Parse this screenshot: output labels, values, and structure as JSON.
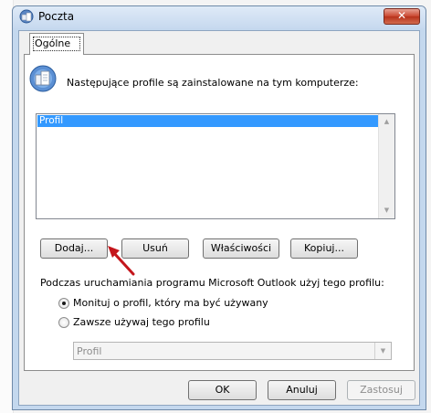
{
  "window": {
    "title": "Poczta",
    "close_symbol": "✕"
  },
  "tabs": [
    {
      "label": "Ogólne",
      "selected": true
    }
  ],
  "profiles": {
    "intro_label": "Następujące profile są zainstalowane na tym komputerze:",
    "items": [
      "Profil"
    ],
    "selected_index": 0
  },
  "actions": {
    "add_label": "Dodaj...",
    "remove_label": "Usuń",
    "properties_label": "Właściwości",
    "copy_label": "Kopiuj..."
  },
  "startup": {
    "label": "Podczas uruchamiania programu Microsoft Outlook użyj tego profilu:",
    "option_prompt_label": "Monituj o profil, który ma być używany",
    "option_prompt_selected": true,
    "option_always_label": "Zawsze używaj tego profilu",
    "option_always_selected": false,
    "profile_combo_value": "Profil"
  },
  "footer": {
    "ok_label": "OK",
    "cancel_label": "Anuluj",
    "apply_label": "Zastosuj"
  },
  "colors": {
    "selection": "#3399ff",
    "annotation_arrow": "#c4161c",
    "close_button": "#c9452e"
  }
}
